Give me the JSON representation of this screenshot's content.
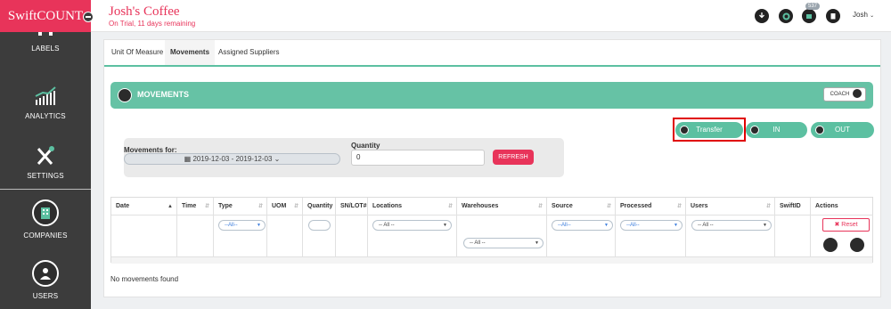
{
  "brand": {
    "name": "SwiftCOUNT"
  },
  "sidebar": {
    "items": [
      {
        "label": "LABELS",
        "icon": "labels-icon"
      },
      {
        "label": "ANALYTICS",
        "icon": "analytics-icon"
      },
      {
        "label": "SETTINGS",
        "icon": "settings-icon"
      },
      {
        "label": "COMPANIES",
        "icon": "companies-icon"
      },
      {
        "label": "USERS",
        "icon": "users-icon"
      }
    ]
  },
  "topbar": {
    "store_name": "Josh's Coffee",
    "trial_text": "On Trial, 11 days remaining",
    "notification_count": "537",
    "user_name": "Josh",
    "icons": [
      "download-icon",
      "gear-icon",
      "notification-icon",
      "clipboard-icon"
    ]
  },
  "tabs": [
    {
      "label": "Unit Of Measure",
      "active": false
    },
    {
      "label": "Movements",
      "active": true
    },
    {
      "label": "Assigned Suppliers",
      "active": false
    }
  ],
  "section": {
    "title": "MOVEMENTS",
    "coach_label": "COACH"
  },
  "movement_buttons": {
    "transfer": "Transfer",
    "in": "IN",
    "out": "OUT"
  },
  "filter": {
    "movements_for_label": "Movements for:",
    "date_range": "2019-12-03 - 2019-12-03",
    "quantity_label": "Quantity",
    "quantity_value": "0",
    "refresh_label": "REFRESH"
  },
  "table": {
    "columns": [
      "Date",
      "Time",
      "Type",
      "UOM",
      "Quantity",
      "SN/LOT#",
      "Locations",
      "Warehouses",
      "Source",
      "Processed",
      "Users",
      "SwiftID",
      "Actions"
    ],
    "filters": {
      "type": "--All--",
      "locations": "-- All --",
      "warehouses": "-- All --",
      "source": "--All--",
      "processed": "--All--",
      "users": "-- All --"
    },
    "reset_label": "Reset",
    "empty_message": "No movements found"
  },
  "colors": {
    "brand": "#e8345a",
    "accent": "#5cc0a1",
    "sidebar": "#3c3c3c"
  }
}
